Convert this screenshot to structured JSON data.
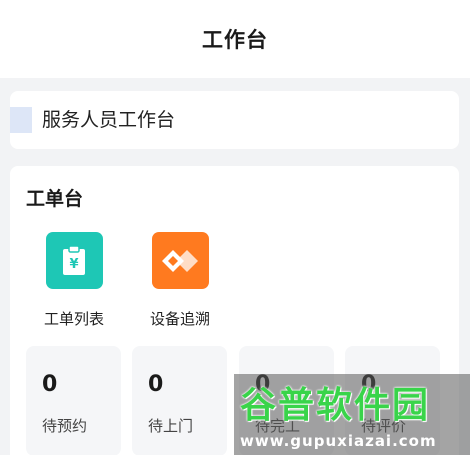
{
  "header": {
    "title": "工作台"
  },
  "role": {
    "label": "服务人员工作台"
  },
  "work_orders": {
    "title": "工单台",
    "shortcuts": [
      {
        "label": "工单列表",
        "icon": "clipboard-yen-icon",
        "color": "#1ec7b5"
      },
      {
        "label": "设备追溯",
        "icon": "trace-diamond-icon",
        "color": "#ff7a1f"
      }
    ],
    "stats": [
      {
        "count": "0",
        "label": "待预约"
      },
      {
        "count": "0",
        "label": "待上门"
      },
      {
        "count": "0",
        "label": "待完工"
      },
      {
        "count": "0",
        "label": "待评价"
      }
    ]
  },
  "watermark": {
    "brand": "谷普软件园",
    "url": "www.gupuxiazai.com"
  }
}
